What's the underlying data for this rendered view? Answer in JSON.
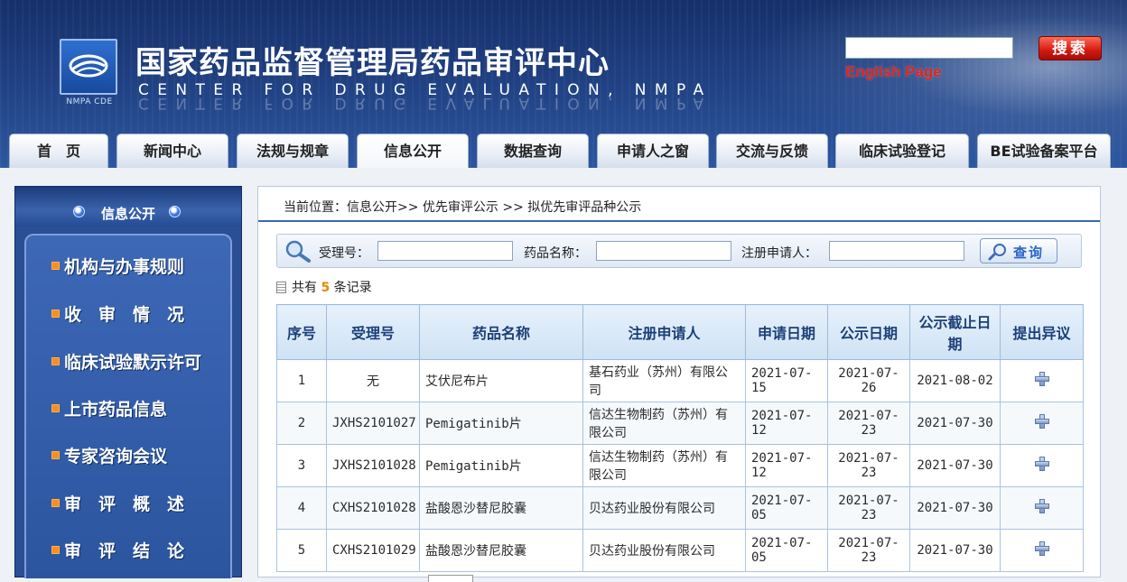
{
  "header": {
    "logo_caption": "NMPA CDE",
    "title": "国家药品监督管理局药品审评中心",
    "subtitle": "CENTER FOR DRUG EVALUATION, NMPA",
    "search_button": "搜索",
    "english_link": "English Page"
  },
  "nav": {
    "tabs": [
      {
        "label": "首　页"
      },
      {
        "label": "新闻中心"
      },
      {
        "label": "法规与规章"
      },
      {
        "label": "信息公开",
        "active": true
      },
      {
        "label": "数据查询"
      },
      {
        "label": "申请人之窗"
      },
      {
        "label": "交流与反馈"
      },
      {
        "label": "临床试验登记"
      },
      {
        "label": "BE试验备案平台"
      }
    ]
  },
  "sidebar": {
    "title": "信息公开",
    "items": [
      {
        "label": "机构与办事规则"
      },
      {
        "label": "收　审　情　况"
      },
      {
        "label": "临床试验默示许可"
      },
      {
        "label": "上市药品信息"
      },
      {
        "label": "专家咨询会议"
      },
      {
        "label": "审　评　概　述"
      },
      {
        "label": "审　评　结　论"
      }
    ]
  },
  "breadcrumb": "当前位置：信息公开>> 优先审评公示 >> 拟优先审评品种公示",
  "filters": {
    "accept_no_label": "受理号：",
    "drug_name_label": "药品名称：",
    "applicant_label": "注册申请人：",
    "query_button": "查询"
  },
  "record_count": {
    "prefix": "共有 ",
    "count": "5",
    "suffix": " 条记录"
  },
  "table": {
    "headers": [
      "序号",
      "受理号",
      "药品名称",
      "注册申请人",
      "申请日期",
      "公示日期",
      "公示截止日期",
      "提出异议"
    ],
    "rows": [
      [
        "1",
        "无",
        "艾伏尼布片",
        "基石药业（苏州）有限公司",
        "2021-07-15",
        "2021-07-26",
        "2021-08-02"
      ],
      [
        "2",
        "JXHS2101027",
        "Pemigatinib片",
        "信达生物制药（苏州）有限公司",
        "2021-07-12",
        "2021-07-23",
        "2021-07-30"
      ],
      [
        "3",
        "JXHS2101028",
        "Pemigatinib片",
        "信达生物制药（苏州）有限公司",
        "2021-07-12",
        "2021-07-23",
        "2021-07-30"
      ],
      [
        "4",
        "CXHS2101028",
        "盐酸恩沙替尼胶囊",
        "贝达药业股份有限公司",
        "2021-07-05",
        "2021-07-23",
        "2021-07-30"
      ],
      [
        "5",
        "CXHS2101029",
        "盐酸恩沙替尼胶囊",
        "贝达药业股份有限公司",
        "2021-07-05",
        "2021-07-23",
        "2021-07-30"
      ]
    ]
  },
  "icons": {
    "objection": "plus-icon",
    "search": "magnifier-icon",
    "feed": "rss-icon"
  }
}
